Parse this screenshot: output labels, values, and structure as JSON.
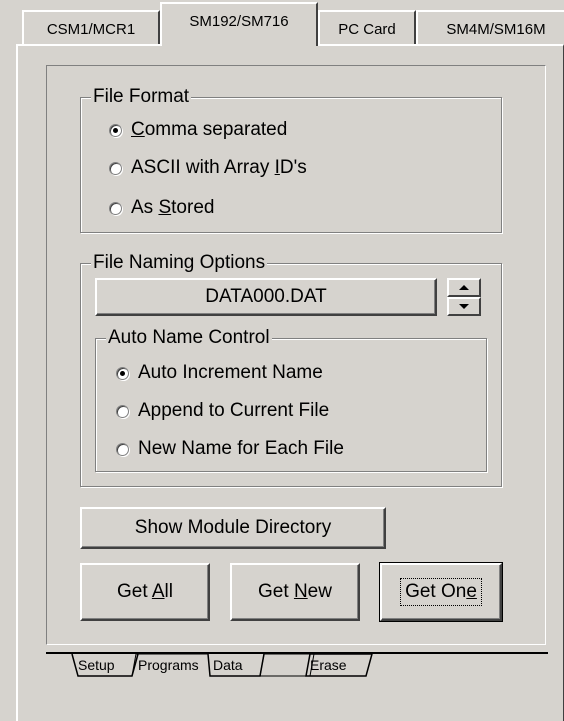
{
  "top_tabs": [
    {
      "label": "CSM1/MCR1",
      "active": false
    },
    {
      "label": "SM192/SM716",
      "active": true
    },
    {
      "label": "PC Card",
      "active": false
    },
    {
      "label": "SM4M/SM16M",
      "active": false
    }
  ],
  "file_format": {
    "title": "File Format",
    "options": [
      {
        "pre": "",
        "key": "C",
        "post": "omma separated",
        "checked": true
      },
      {
        "pre": "ASCII with Array ",
        "key": "I",
        "post": "D's",
        "checked": false
      },
      {
        "pre": "As ",
        "key": "S",
        "post": "tored",
        "checked": false
      }
    ]
  },
  "file_naming": {
    "title": "File Naming Options",
    "filename": "DATA000.DAT",
    "auto_name": {
      "title": "Auto Name Control",
      "options": [
        {
          "label": "Auto Increment Name",
          "checked": true
        },
        {
          "label": "Append to Current File",
          "checked": false
        },
        {
          "label": "New Name for Each File",
          "checked": false
        }
      ]
    }
  },
  "buttons": {
    "show_dir": "Show Module Directory",
    "get_all": {
      "pre": "Get ",
      "key": "A",
      "post": "ll"
    },
    "get_new": {
      "pre": "Get ",
      "key": "N",
      "post": "ew"
    },
    "get_one": {
      "pre": "Get On",
      "key": "e",
      "post": ""
    }
  },
  "bottom_tabs": [
    "Setup",
    "Programs",
    "Data",
    "Erase"
  ]
}
